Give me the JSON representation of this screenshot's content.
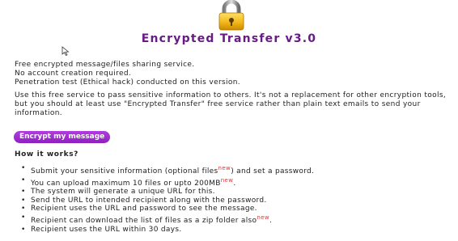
{
  "app": {
    "title": "Encrypted Transfer v3.0",
    "logo_icon": "padlock-icon",
    "accent_color": "#6a1a86",
    "button_color": "#a02fd2",
    "new_tag_color": "#d93838"
  },
  "intro": {
    "lines": [
      "Free encrypted message/files sharing service.",
      "No account creation required.",
      "Penetration test (Ethical hack) conducted on this version."
    ]
  },
  "usage_text": "Use this free service to pass sensitive information to others. It's not a replacement for other encryption tools, but you should at least use \"Encrypted Transfer\" free service rather than plain text emails to send your information.",
  "actions": {
    "encrypt_label": "Encrypt my message"
  },
  "how_it_works": {
    "heading": "How it works?",
    "new_label": "new",
    "steps": [
      {
        "text": "Submit your sensitive information (optional files",
        "new": true,
        "suffix": ") and set a password."
      },
      {
        "text": "You can upload maximum 10 files or upto 200MB",
        "new": true,
        "suffix": "."
      },
      {
        "text": "The system will generate a unique URL for this.",
        "new": false,
        "suffix": ""
      },
      {
        "text": "Send the URL to intended recipient along with the password.",
        "new": false,
        "suffix": ""
      },
      {
        "text": "Recipient uses the URL and password to see the message.",
        "new": false,
        "suffix": ""
      },
      {
        "text": "Recipient can download the list of files as a zip folder also",
        "new": true,
        "suffix": "."
      },
      {
        "text": "Recipient uses the URL within 30 days.",
        "new": false,
        "suffix": ""
      }
    ]
  }
}
